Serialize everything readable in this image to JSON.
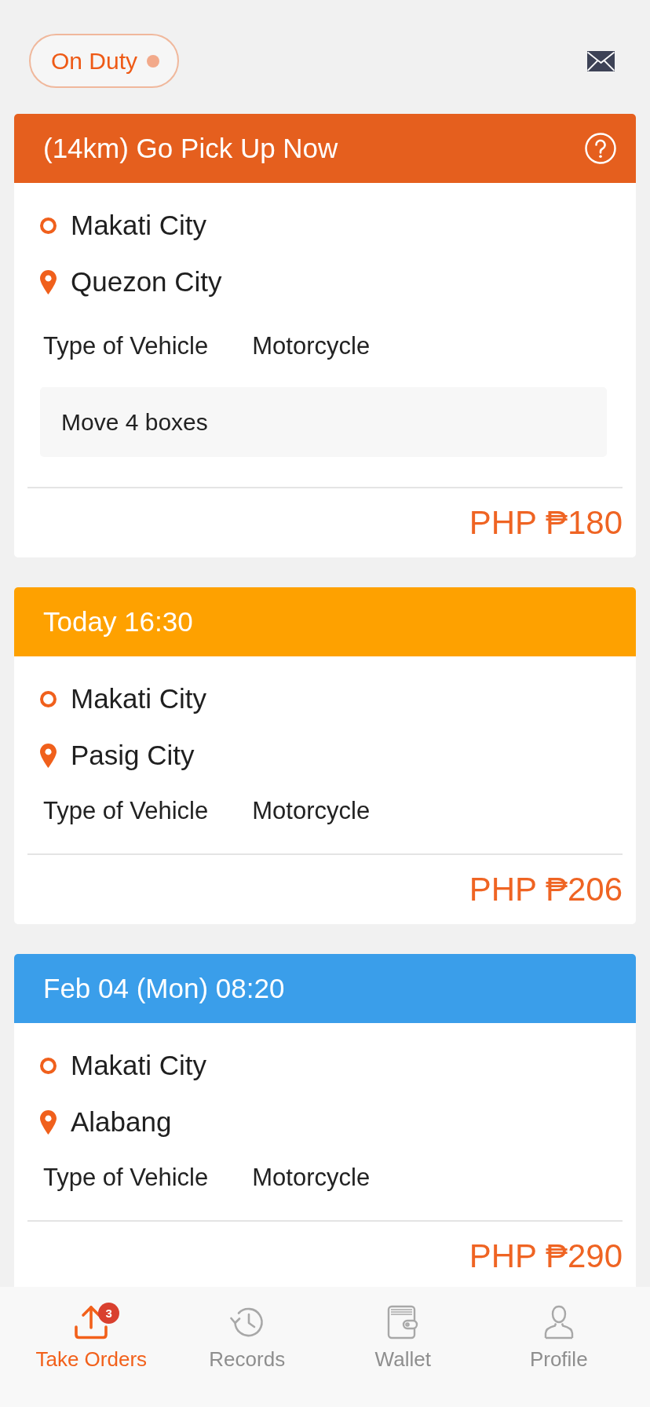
{
  "status_pill": {
    "label": "On Duty",
    "on": true
  },
  "orders": [
    {
      "kind": "instant",
      "color": "#e55f1e",
      "title": "(14km) Go Pick Up Now",
      "pickup": "Makati City",
      "dropoff": "Quezon City",
      "vehicle_label": "Type of Vehicle",
      "vehicle": "Motorcycle",
      "note": "Move 4 boxes",
      "price": "PHP ₱180"
    },
    {
      "kind": "scheduled",
      "color": "#fea100",
      "title": "Today 16:30",
      "pickup": "Makati City",
      "dropoff": "Pasig City",
      "vehicle_label": "Type of Vehicle",
      "vehicle": "Motorcycle",
      "price": "PHP ₱206"
    },
    {
      "kind": "scheduled",
      "color": "#3a9eea",
      "title": "Feb 04 (Mon) 08:20",
      "pickup": "Makati City",
      "dropoff": "Alabang",
      "vehicle_label": "Type of Vehicle",
      "vehicle": "Motorcycle",
      "price": "PHP ₱290"
    }
  ],
  "tabs": [
    {
      "label": "Take Orders",
      "selected": true,
      "badge": "3"
    },
    {
      "label": "Records",
      "selected": false
    },
    {
      "label": "Wallet",
      "selected": false
    },
    {
      "label": "Profile",
      "selected": false
    }
  ]
}
